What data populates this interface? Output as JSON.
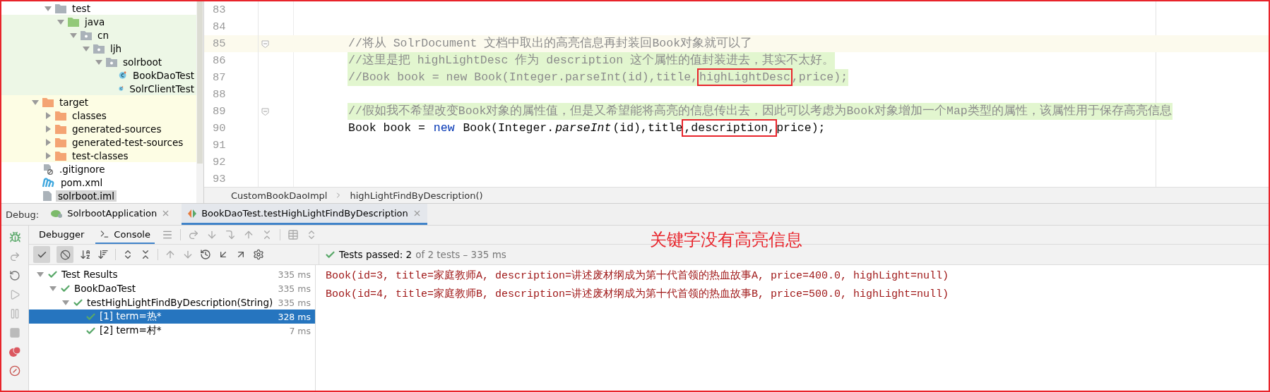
{
  "project_tree": {
    "items": [
      {
        "kind": "cut-off",
        "children": [
          {
            "label": "test",
            "kind": "folder",
            "expanded": true,
            "color": "#ffffff",
            "selected": false,
            "children": [
              {
                "label": "java",
                "kind": "source-folder",
                "expanded": true,
                "color": "#edf7e6",
                "selected": false,
                "children": [
                  {
                    "label": "cn",
                    "kind": "package",
                    "expanded": true,
                    "color": "#edf7e6",
                    "selected": false,
                    "children": [
                      {
                        "label": "ljh",
                        "kind": "package",
                        "expanded": true,
                        "color": "#edf7e6",
                        "selected": false,
                        "children": [
                          {
                            "label": "solrboot",
                            "kind": "package",
                            "expanded": true,
                            "color": "#edf7e6",
                            "selected": false,
                            "children": [
                              {
                                "label": "BookDaoTest",
                                "kind": "test-class",
                                "color": "#edf7e6",
                                "selected": false
                              },
                              {
                                "label": "SolrClientTest",
                                "kind": "test-class",
                                "color": "#edf7e6",
                                "selected": false
                              }
                            ]
                          }
                        ]
                      }
                    ]
                  }
                ]
              }
            ]
          }
        ]
      },
      {
        "label": "target",
        "kind": "excluded-folder",
        "expanded": true,
        "color": "#fdfde4",
        "selected": false,
        "children": [
          {
            "label": "classes",
            "kind": "excluded-folder",
            "expanded": false,
            "color": "#fdfde4",
            "selected": false
          },
          {
            "label": "generated-sources",
            "kind": "excluded-folder",
            "expanded": false,
            "color": "#fdfde4",
            "selected": false
          },
          {
            "label": "generated-test-sources",
            "kind": "excluded-folder",
            "expanded": false,
            "color": "#fdfde4",
            "selected": false
          },
          {
            "label": "test-classes",
            "kind": "excluded-folder",
            "expanded": false,
            "color": "#fdfde4",
            "selected": false
          }
        ]
      },
      {
        "label": ".gitignore",
        "kind": "ignore-file",
        "color": "#ffffff",
        "selected": false
      },
      {
        "label": "pom.xml",
        "kind": "maven-file",
        "color": "#ffffff",
        "selected": false
      },
      {
        "label": "solrboot.iml",
        "kind": "module-file",
        "color": "#ffffff",
        "selected": true
      }
    ]
  },
  "editor": {
    "lines": [
      {
        "number": "83",
        "current": false,
        "fold": false
      },
      {
        "number": "84",
        "current": false,
        "fold": false
      },
      {
        "number": "85",
        "current": true,
        "highlight": false,
        "fold": true,
        "tokens": [
          {
            "text": "//将从 SolrDocument 文档中取出的高亮信息再封装回Book对象就可以了",
            "kind": "comment",
            "boxed": false
          }
        ]
      },
      {
        "number": "86",
        "current": false,
        "highlight": true,
        "fold": false,
        "tokens": [
          {
            "text": "//这里是把 highLightDesc 作为 description 这个属性的值封装进去，其实不太好。",
            "kind": "comment",
            "boxed": false
          }
        ]
      },
      {
        "number": "87",
        "current": false,
        "highlight": true,
        "fold": false,
        "tokens": [
          {
            "text": "//Book book = new Book(Integer.parseInt(id),title,",
            "kind": "comment",
            "boxed": false
          },
          {
            "text": "highLightDesc",
            "kind": "comment",
            "boxed": true
          },
          {
            "text": ",price);",
            "kind": "comment",
            "boxed": false
          }
        ]
      },
      {
        "number": "88",
        "current": false,
        "fold": false
      },
      {
        "number": "89",
        "current": false,
        "highlight": true,
        "fold": true,
        "tokens": [
          {
            "text": "//假如我不希望改变Book对象的属性值，但是又希望能将高亮的信息传出去，因此可以考虑为Book对象增加一个Map类型的属性，该属性用于保存高亮信息",
            "kind": "comment",
            "boxed": false
          }
        ]
      },
      {
        "number": "90",
        "current": false,
        "highlight": false,
        "fold": false,
        "tokens": [
          {
            "text": "Book book = ",
            "kind": "plain",
            "boxed": false
          },
          {
            "text": "new",
            "kind": "keyword",
            "boxed": false
          },
          {
            "text": " Book(Integer.",
            "kind": "plain",
            "boxed": false
          },
          {
            "text": "parseInt",
            "kind": "method",
            "boxed": false
          },
          {
            "text": "(id),title",
            "kind": "plain",
            "boxed": false
          },
          {
            "text": ",description,",
            "kind": "plain",
            "boxed": true
          },
          {
            "text": "price);",
            "kind": "plain",
            "boxed": false
          }
        ]
      },
      {
        "number": "91",
        "current": false,
        "fold": false
      },
      {
        "number": "92",
        "current": false,
        "fold": false
      },
      {
        "number": "93",
        "current": false,
        "fold": false
      }
    ],
    "breadcrumb": [
      "CustomBookDaoImpl",
      "highLightFindByDescription()"
    ]
  },
  "debug": {
    "label": "Debug:",
    "sessions": [
      {
        "label": "SolrbootApplication",
        "kind": "app",
        "selected": false
      },
      {
        "label": "BookDaoTest.testHighLightFindByDescription",
        "kind": "test",
        "selected": true
      }
    ],
    "panel_tabs": [
      {
        "label": "Debugger",
        "selected": false
      },
      {
        "label": "Console",
        "selected": true
      }
    ],
    "test_filters": {
      "show_passed": true,
      "show_ignored": true
    },
    "status": {
      "summary": "Tests passed: 2",
      "detail": "of 2 tests – 335 ms"
    },
    "tests": [
      {
        "label": "Test Results",
        "time": "335 ms",
        "passed": true,
        "selected": false,
        "expanded": true,
        "children": [
          {
            "label": "BookDaoTest",
            "time": "335 ms",
            "passed": true,
            "selected": false,
            "expanded": true,
            "children": [
              {
                "label": "testHighLightFindByDescription(String)",
                "time": "335 ms",
                "passed": true,
                "selected": false,
                "expanded": true,
                "children": [
                  {
                    "label": "[1] term=热*",
                    "time": "328 ms",
                    "passed": true,
                    "selected": true
                  },
                  {
                    "label": "[2] term=村*",
                    "time": "7 ms",
                    "passed": true,
                    "selected": false
                  }
                ]
              }
            ]
          }
        ]
      }
    ],
    "console": [
      "Book(id=3, title=家庭教师A, description=讲述废材纲成为第十代首领的热血故事A, price=400.0, highLight=null)",
      "Book(id=4, title=家庭教师B, description=讲述废材纲成为第十代首领的热血故事B, price=500.0, highLight=null)"
    ]
  },
  "annotation": "关键字没有高亮信息"
}
